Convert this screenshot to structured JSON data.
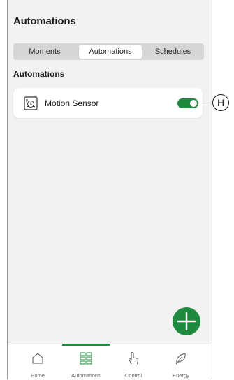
{
  "header": {
    "title": "Automations"
  },
  "tabs": [
    {
      "label": "Moments",
      "active": false
    },
    {
      "label": "Automations",
      "active": true
    },
    {
      "label": "Schedules",
      "active": false
    }
  ],
  "section": {
    "title": "Automations"
  },
  "automations": [
    {
      "label": "Motion Sensor",
      "icon": "motion-sensor-icon",
      "enabled": true
    }
  ],
  "callout": {
    "letter": "H"
  },
  "fab": {
    "icon": "plus-icon"
  },
  "bottom_nav": [
    {
      "label": "Home",
      "icon": "home-icon",
      "active": false
    },
    {
      "label": "Automations",
      "icon": "grid-icon",
      "active": true
    },
    {
      "label": "Control",
      "icon": "hand-icon",
      "active": false
    },
    {
      "label": "Energy",
      "icon": "leaf-icon",
      "active": false
    }
  ],
  "colors": {
    "accent": "#1f8a3f",
    "background": "#f2f2f2"
  }
}
